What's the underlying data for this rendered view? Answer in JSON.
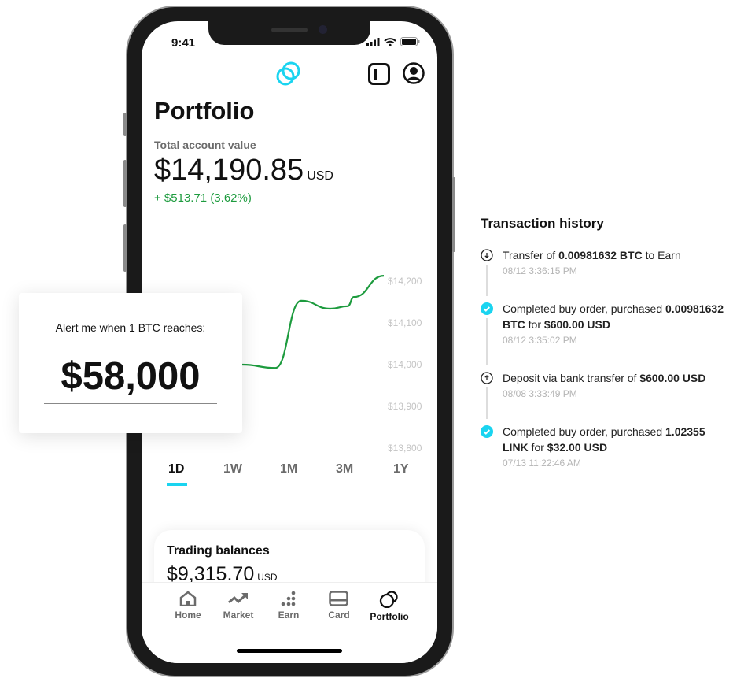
{
  "status_bar": {
    "time": "9:41"
  },
  "header": {
    "logo": "gemini-logo",
    "icons": [
      "sidebar-toggle-icon",
      "account-icon"
    ]
  },
  "portfolio": {
    "title": "Portfolio",
    "total_label": "Total account value",
    "total_value": "$14,190.85",
    "currency": "USD",
    "change": "+ $513.71 (3.62%)"
  },
  "chart_data": {
    "type": "line",
    "x": [
      0,
      1,
      2,
      3,
      4,
      5,
      6,
      7
    ],
    "values": [
      14011,
      14000,
      13992,
      14153,
      14134,
      14140,
      14162,
      14213
    ],
    "y_ticks": [
      "$14,200",
      "$14,100",
      "$14,000",
      "$13,900",
      "$13,800"
    ],
    "ylim": [
      13800,
      14200
    ],
    "line_color": "#1d9b3e",
    "grid": false
  },
  "ranges": [
    "1D",
    "1W",
    "1M",
    "3M",
    "1Y"
  ],
  "active_range": "1D",
  "trading": {
    "label": "Trading balances",
    "value": "$9,315.70",
    "currency": "USD"
  },
  "nav": [
    {
      "label": "Home",
      "icon": "home-icon"
    },
    {
      "label": "Market",
      "icon": "trending-up-icon"
    },
    {
      "label": "Earn",
      "icon": "dots-icon"
    },
    {
      "label": "Card",
      "icon": "card-icon"
    },
    {
      "label": "Portfolio",
      "icon": "coins-icon",
      "active": true
    }
  ],
  "alert": {
    "text": "Alert me when 1 BTC reaches:",
    "price": "$58,000"
  },
  "transactions": {
    "title": "Transaction history",
    "items": [
      {
        "icon": "arrow-down-circle-icon",
        "pre": "Transfer of ",
        "b1": "0.00981632 BTC",
        "mid": " to Earn",
        "b2": "",
        "date": "08/12 3:36:15 PM"
      },
      {
        "icon": "check-circle-icon",
        "pre": "Completed buy order, purchased ",
        "b1": "0.00981632 BTC",
        "mid": " for ",
        "b2": "$600.00 USD",
        "date": "08/12 3:35:02 PM"
      },
      {
        "icon": "arrow-up-circle-icon",
        "pre": "Deposit via bank transfer of ",
        "b1": "$600.00 USD",
        "mid": "",
        "b2": "",
        "date": "08/08 3:33:49 PM"
      },
      {
        "icon": "check-circle-icon",
        "pre": "Completed buy order, purchased ",
        "b1": "1.02355 LINK",
        "mid": " for ",
        "b2": "$32.00 USD",
        "date": "07/13 11:22:46 AM"
      }
    ]
  },
  "colors": {
    "accent": "#1ad4f0",
    "positive": "#1d9b3e"
  }
}
